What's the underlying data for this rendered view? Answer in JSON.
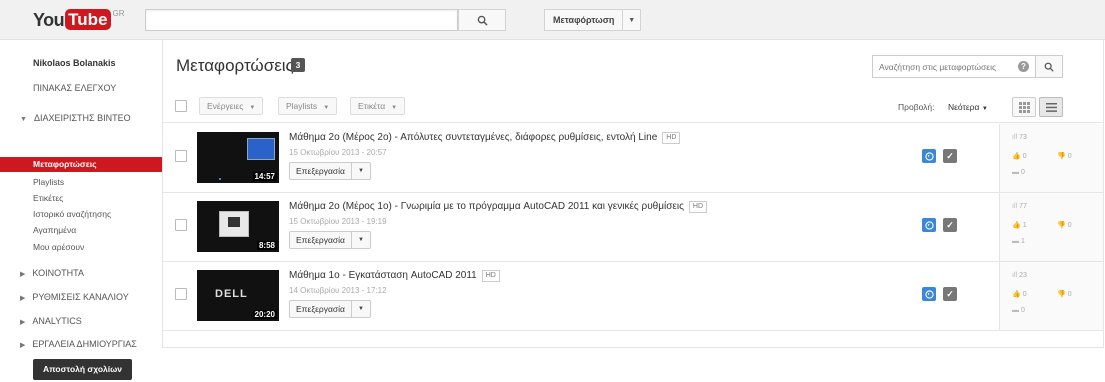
{
  "header": {
    "logo_you": "You",
    "logo_tube": "Tube",
    "logo_region": "GR",
    "search_value": "",
    "upload_label": "Μεταφόρτωση"
  },
  "sidebar": {
    "user_name": "Nikolaos Bolanakis",
    "dashboard": "ΠΙΝΑΚΑΣ ΕΛΕΓΧΟΥ",
    "video_manager": "ΔΙΑΧΕΙΡΙΣΤΗΣ ΒΙΝΤΕΟ",
    "items": [
      {
        "label": "Μεταφορτώσεις"
      },
      {
        "label": "Playlists"
      },
      {
        "label": "Ετικέτες"
      },
      {
        "label": "Ιστορικό αναζήτησης"
      },
      {
        "label": "Αγαπημένα"
      },
      {
        "label": "Μου αρέσουν"
      }
    ],
    "sections": [
      {
        "label": "ΚΟΙΝΟΤΗΤΑ"
      },
      {
        "label": "ΡΥΘΜΙΣΕΙΣ ΚΑΝΑΛΙΟΥ"
      },
      {
        "label": "ANALYTICS"
      },
      {
        "label": "ΕΡΓΑΛΕΙΑ ΔΗΜΙΟΥΡΓΙΑΣ"
      }
    ],
    "feedback_button": "Αποστολή σχολίων"
  },
  "main": {
    "title": "Μεταφορτώσεις",
    "count": "3",
    "search_placeholder": "Αναζήτηση στις μεταφορτώσεις",
    "actions_label": "Ενέργειες",
    "playlists_label": "Playlists",
    "tag_label": "Ετικέτα",
    "view_label": "Προβολή:",
    "sort_value": "Νεότερα"
  },
  "videos": [
    {
      "title": "Μάθημα 2ο (Μέρος 2ο) - Απόλυτες συντεταγμένες, διάφορες ρυθμίσεις, εντολή Line",
      "hd": "HD",
      "date": "15 Οκτωβρίου 2013 - 20:57",
      "duration": "14:57",
      "edit_label": "Επεξεργασία",
      "views": "73",
      "likes": "0",
      "dislikes": "0",
      "comments": "0"
    },
    {
      "title": "Μάθημα 2ο (Μέρος 1ο) - Γνωριμία με το πρόγραμμα AutoCAD 2011 και γενικές ρυθμίσεις",
      "hd": "HD",
      "date": "15 Οκτωβρίου 2013 - 19:19",
      "duration": "8:58",
      "edit_label": "Επεξεργασία",
      "views": "77",
      "likes": "1",
      "dislikes": "0",
      "comments": "1"
    },
    {
      "title": "Μάθημα 1ο - Εγκατάσταση AutoCAD 2011",
      "hd": "HD",
      "date": "14 Οκτωβρίου 2013 - 17:12",
      "duration": "20:20",
      "thumb_text": "DELL",
      "edit_label": "Επεξεργασία",
      "views": "23",
      "likes": "0",
      "dislikes": "0",
      "comments": "0"
    }
  ],
  "colors": {
    "brand_red": "#cc181e",
    "public_blue": "#3b86d6"
  }
}
